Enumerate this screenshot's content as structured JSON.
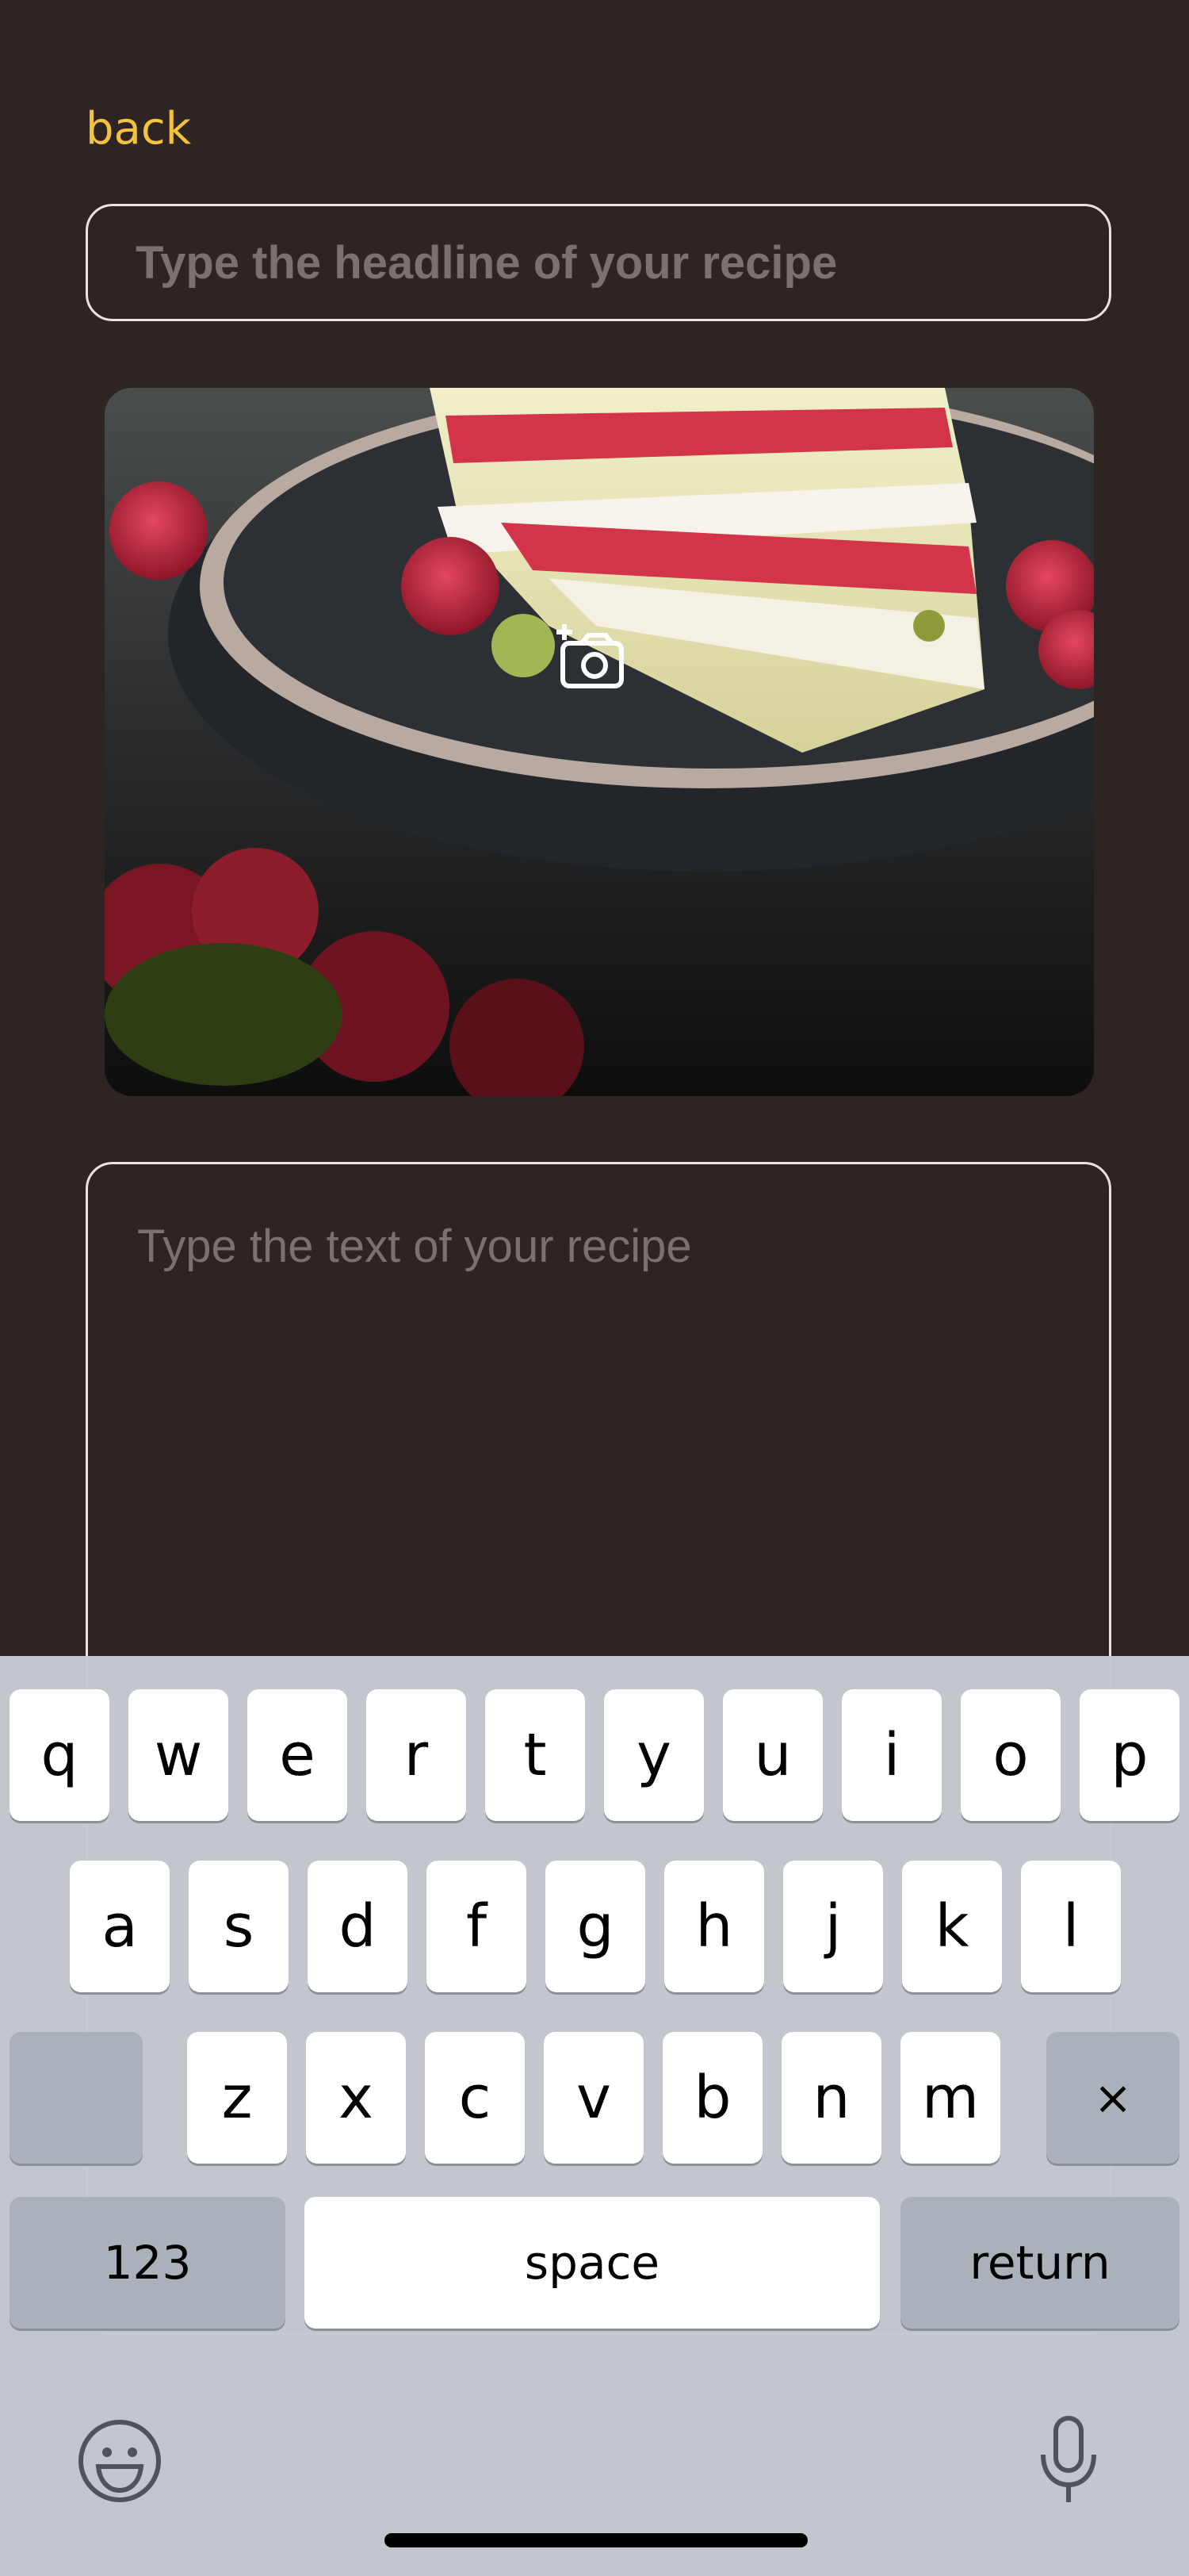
{
  "nav": {
    "back_label": "back"
  },
  "form": {
    "headline_placeholder": "Type the headline of your recipe",
    "text_placeholder": "Type the text of your recipe",
    "photo_icon": "add-photo-camera-icon"
  },
  "keyboard": {
    "row1": [
      "q",
      "w",
      "e",
      "r",
      "t",
      "y",
      "u",
      "i",
      "o",
      "p"
    ],
    "row2": [
      "a",
      "s",
      "d",
      "f",
      "g",
      "h",
      "j",
      "k",
      "l"
    ],
    "row3": [
      "z",
      "x",
      "c",
      "v",
      "b",
      "n",
      "m"
    ],
    "delete_symbol": "×",
    "numbers_label": "123",
    "space_label": "space",
    "return_label": "return",
    "emoji_icon": "emoji-icon",
    "mic_icon": "microphone-icon"
  },
  "colors": {
    "background": "#2e2523",
    "accent": "#f2c240",
    "keyboard_bg": "#c6c9d0"
  }
}
